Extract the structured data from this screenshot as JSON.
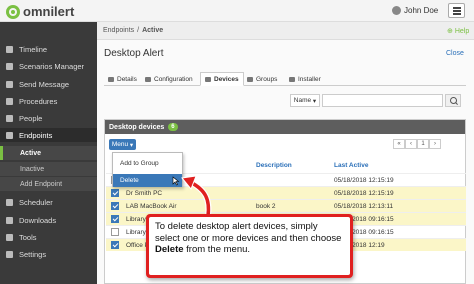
{
  "app": {
    "logo_text": "omnilert",
    "user_name": "John Doe"
  },
  "sidebar": {
    "items": [
      {
        "label": "Timeline",
        "icon": "clock-icon"
      },
      {
        "label": "Scenarios Manager",
        "icon": "gear-icon"
      },
      {
        "label": "Send Message",
        "icon": "send-icon"
      },
      {
        "label": "Procedures",
        "icon": "list-icon"
      },
      {
        "label": "People",
        "icon": "people-icon"
      },
      {
        "label": "Endpoints",
        "icon": "endpoint-icon"
      },
      {
        "label": "Scheduler",
        "icon": "calendar-icon"
      },
      {
        "label": "Downloads",
        "icon": "download-icon"
      },
      {
        "label": "Tools",
        "icon": "wrench-icon"
      },
      {
        "label": "Settings",
        "icon": "settings-icon"
      }
    ],
    "subitems": [
      "Active",
      "Inactive",
      "Add Endpoint"
    ]
  },
  "breadcrumb": {
    "root": "Endpoints",
    "current": "Active"
  },
  "help_label": "Help",
  "page": {
    "title": "Desktop Alert",
    "close_label": "Close"
  },
  "tabs": [
    "Details",
    "Configuration",
    "Devices",
    "Groups",
    "Installer"
  ],
  "search": {
    "field_label": "Name"
  },
  "panel": {
    "title": "Desktop devices",
    "count": "6",
    "menu_label": "Menu",
    "pager": [
      "«",
      "‹",
      "1",
      "›"
    ],
    "columns": {
      "description": "Description",
      "last_active": "Last Active"
    }
  },
  "dropdown": {
    "items": [
      "Add to Group",
      "Delete"
    ]
  },
  "rows": [
    {
      "name": "",
      "description": "",
      "last_active": "05/18/2018 12:15:19",
      "checked": false
    },
    {
      "name": "Dr Smith PC",
      "description": "",
      "last_active": "05/18/2018 12:15:19",
      "checked": true
    },
    {
      "name": "LAB MacBook Air",
      "description": "book 2",
      "last_active": "05/18/2018 12:13:11",
      "checked": true
    },
    {
      "name": "Library d",
      "description": "",
      "last_active": "05/18/2018 09:16:15",
      "checked": true
    },
    {
      "name": "Library",
      "description": "",
      "last_active": "05/18/2018 09:16:15",
      "checked": false
    },
    {
      "name": "Office PC",
      "description": "",
      "last_active": "05/18/2018 12:19",
      "checked": true
    }
  ],
  "callout": {
    "text_before": "To delete desktop alert devices, simply select one or more devices and then choose ",
    "bold": "Delete",
    "text_after": " from the menu."
  },
  "colors": {
    "accent": "#7bc043",
    "primary": "#3a78b8",
    "callout": "#e02020",
    "sidebar": "#3a3a3a"
  }
}
